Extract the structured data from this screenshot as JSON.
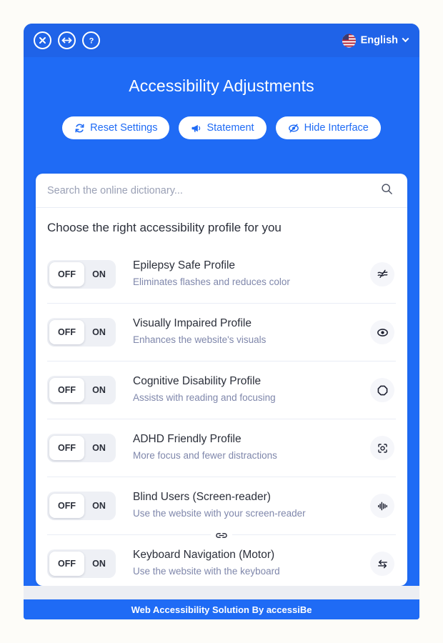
{
  "topbar": {
    "close_icon": "close-icon",
    "resize_icon": "resize-horizontal-icon",
    "help_icon": "question-mark-icon",
    "language": "English",
    "flag_icon": "us-flag-icon",
    "chevron_icon": "chevron-down-icon"
  },
  "header": {
    "title": "Accessibility Adjustments",
    "buttons": [
      {
        "label": "Reset Settings",
        "icon": "reset-circular-arrows-icon"
      },
      {
        "label": "Statement",
        "icon": "megaphone-icon"
      },
      {
        "label": "Hide Interface",
        "icon": "eye-slash-icon"
      }
    ]
  },
  "search": {
    "placeholder": "Search the online dictionary...",
    "value": "",
    "icon": "search-icon"
  },
  "card": {
    "heading": "Choose the right accessibility profile for you",
    "toggle_off_label": "OFF",
    "toggle_on_label": "ON",
    "link_icon": "chain-link-icon",
    "profiles": [
      {
        "name": "Epilepsy Safe Profile",
        "desc": "Eliminates flashes and reduces color",
        "state": "OFF",
        "icon": "waves-slash-icon"
      },
      {
        "name": "Visually Impaired Profile",
        "desc": "Enhances the website's visuals",
        "state": "OFF",
        "icon": "eye-icon"
      },
      {
        "name": "Cognitive Disability Profile",
        "desc": "Assists with reading and focusing",
        "state": "OFF",
        "icon": "octagon-icon"
      },
      {
        "name": "ADHD Friendly Profile",
        "desc": "More focus and fewer distractions",
        "state": "OFF",
        "icon": "focus-target-icon"
      },
      {
        "name": "Blind Users (Screen-reader)",
        "desc": "Use the website with your screen-reader",
        "state": "OFF",
        "icon": "audio-waveform-icon"
      },
      {
        "name": "Keyboard Navigation (Motor)",
        "desc": "Use the website with the keyboard",
        "state": "OFF",
        "icon": "swap-arrows-icon"
      }
    ]
  },
  "footer": {
    "text": "Web Accessibility Solution By accessiBe"
  },
  "colors": {
    "brand_blue": "#1f6bf5",
    "topbar_blue": "#1f63e8",
    "page_bg": "#fdfcf8",
    "desc_text": "#7f87ab"
  }
}
